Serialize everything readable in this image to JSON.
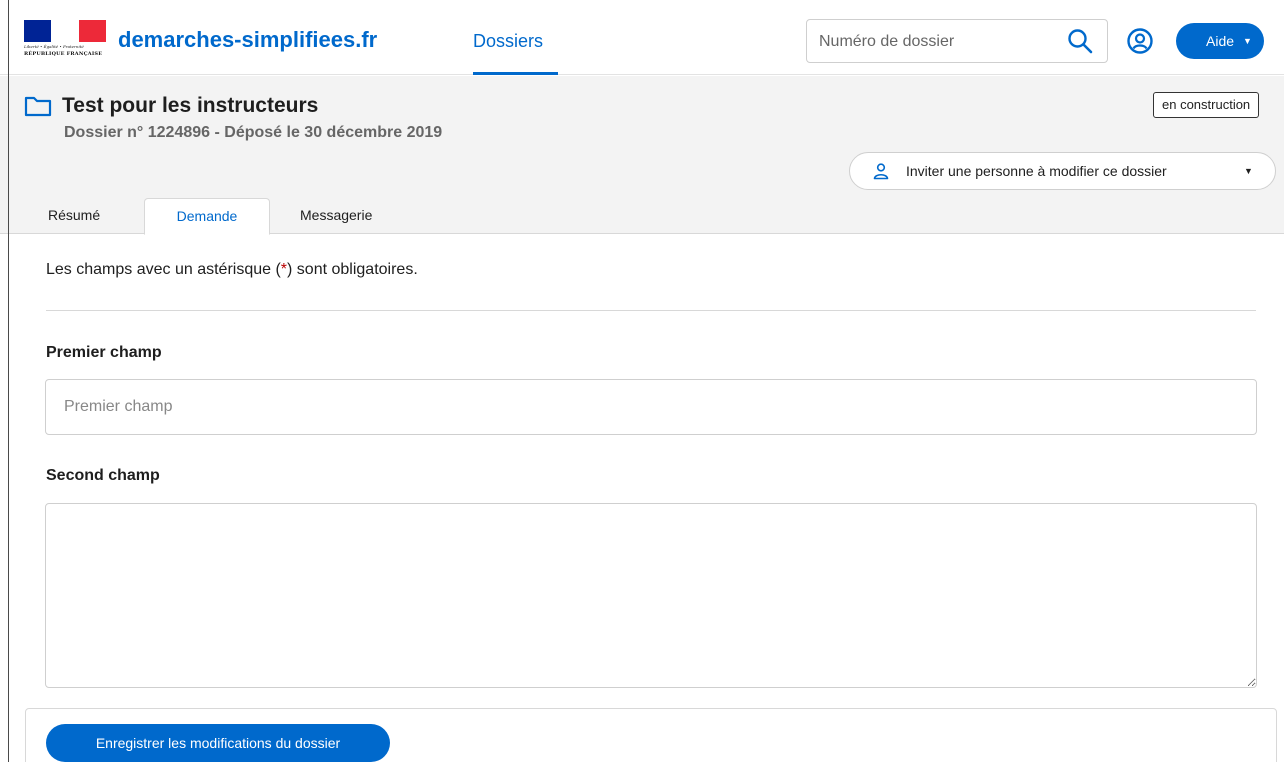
{
  "colors": {
    "brand_blue": "#0069cc",
    "required_star": "#b90000",
    "header_band": "#f3f3f3"
  },
  "header": {
    "logo": {
      "motto": "Liberté • Égalité • Fraternité",
      "country": "RÉPUBLIQUE FRANÇAISE",
      "icon": "marianne-logo"
    },
    "site_name": "demarches-simplifiees.fr",
    "nav_dossiers": "Dossiers",
    "search": {
      "placeholder": "Numéro de dossier",
      "value": "",
      "icon": "search-icon"
    },
    "account_icon": "user-circle-icon",
    "help_button": "Aide"
  },
  "dossier": {
    "icon": "folder-icon",
    "title": "Test pour les instructeurs",
    "subtitle": "Dossier n° 1224896 - Déposé le 30 décembre 2019",
    "status_badge": "en construction",
    "invite_button": "Inviter une personne à modifier ce dossier",
    "invite_icon": "person-icon"
  },
  "tabs": [
    {
      "label": "Résumé",
      "active": false
    },
    {
      "label": "Demande",
      "active": true
    },
    {
      "label": "Messagerie",
      "active": false
    }
  ],
  "form": {
    "notice_before": "Les champs avec un astérisque (",
    "notice_star": "*",
    "notice_after": ") sont obligatoires.",
    "fields": [
      {
        "label": "Premier champ",
        "placeholder": "Premier champ",
        "value": ""
      },
      {
        "label": "Second champ",
        "placeholder": "",
        "value": ""
      }
    ],
    "submit_label": "Enregistrer les modifications du dossier"
  }
}
